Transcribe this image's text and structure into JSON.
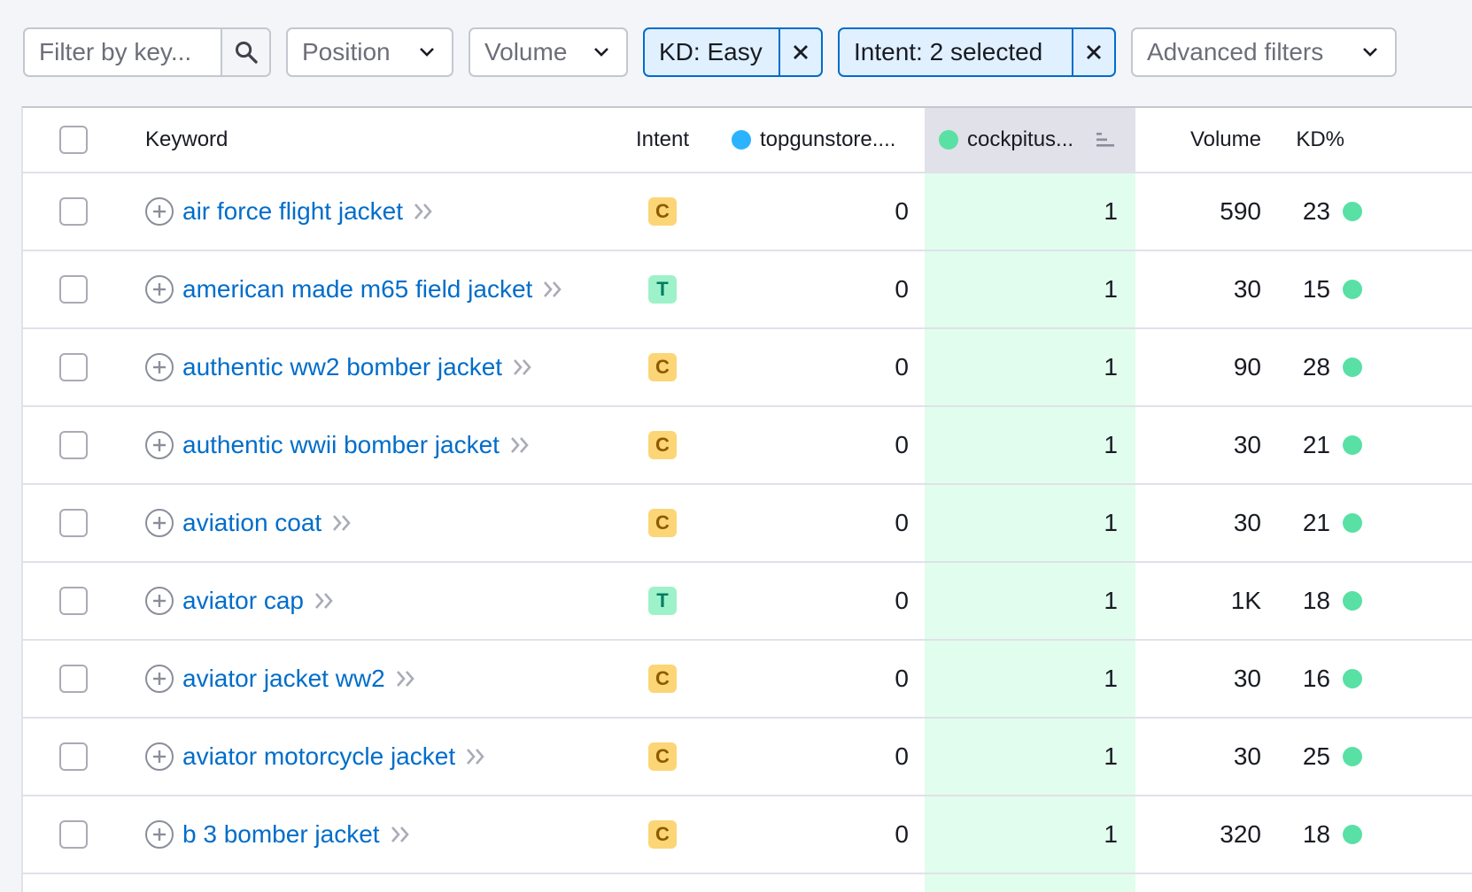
{
  "filters": {
    "search_placeholder": "Filter by key...",
    "position_label": "Position",
    "volume_label": "Volume",
    "kd_chip_label": "KD: Easy",
    "intent_chip_label": "Intent: 2 selected",
    "advanced_label": "Advanced filters"
  },
  "table": {
    "headers": {
      "keyword": "Keyword",
      "intent": "Intent",
      "domain1": "topgunstore....",
      "domain2": "cockpitus...",
      "volume": "Volume",
      "kd": "KD%"
    },
    "colors": {
      "domain1_dot": "#2bb3ff",
      "domain2_dot": "#59e0a5",
      "kd_easy": "#59e0a5",
      "highlight_column": "#e1fdee"
    },
    "rows": [
      {
        "keyword": "air force flight jacket",
        "intent": "C",
        "domain1_pos": "0",
        "domain2_pos": "1",
        "volume": "590",
        "kd": "23"
      },
      {
        "keyword": "american made m65 field jacket",
        "intent": "T",
        "domain1_pos": "0",
        "domain2_pos": "1",
        "volume": "30",
        "kd": "15"
      },
      {
        "keyword": "authentic ww2 bomber jacket",
        "intent": "C",
        "domain1_pos": "0",
        "domain2_pos": "1",
        "volume": "90",
        "kd": "28"
      },
      {
        "keyword": "authentic wwii bomber jacket",
        "intent": "C",
        "domain1_pos": "0",
        "domain2_pos": "1",
        "volume": "30",
        "kd": "21"
      },
      {
        "keyword": "aviation coat",
        "intent": "C",
        "domain1_pos": "0",
        "domain2_pos": "1",
        "volume": "30",
        "kd": "21"
      },
      {
        "keyword": "aviator cap",
        "intent": "T",
        "domain1_pos": "0",
        "domain2_pos": "1",
        "volume": "1K",
        "kd": "18"
      },
      {
        "keyword": "aviator jacket ww2",
        "intent": "C",
        "domain1_pos": "0",
        "domain2_pos": "1",
        "volume": "30",
        "kd": "16"
      },
      {
        "keyword": "aviator motorcycle jacket",
        "intent": "C",
        "domain1_pos": "0",
        "domain2_pos": "1",
        "volume": "30",
        "kd": "25"
      },
      {
        "keyword": "b 3 bomber jacket",
        "intent": "C",
        "domain1_pos": "0",
        "domain2_pos": "1",
        "volume": "320",
        "kd": "18"
      }
    ]
  }
}
